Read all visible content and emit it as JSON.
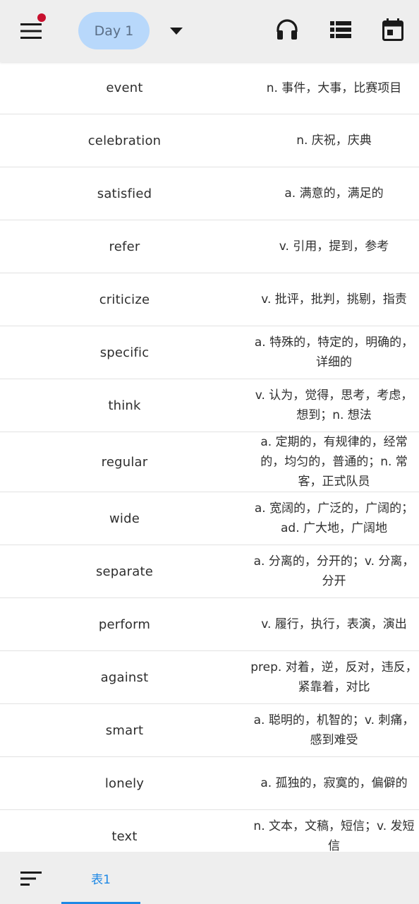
{
  "header": {
    "day_label": "Day 1"
  },
  "words": [
    {
      "word": "event",
      "meaning": "n. 事件，大事，比赛项目",
      "h": 74
    },
    {
      "word": "celebration",
      "meaning": "n. 庆祝，庆典",
      "h": 75
    },
    {
      "word": "satisfied",
      "meaning": "a. 满意的，满足的",
      "h": 75
    },
    {
      "word": "refer",
      "meaning": "v. 引用，提到，参考",
      "h": 75
    },
    {
      "word": "criticize",
      "meaning": "v. 批评，批判，挑剔，指责",
      "h": 75
    },
    {
      "word": "specific",
      "meaning": "a. 特殊的，特定的，明确的，详细的",
      "h": 75
    },
    {
      "word": "think",
      "meaning": "v. 认为，觉得，思考，考虑，想到；n. 想法",
      "h": 75
    },
    {
      "word": "regular",
      "meaning": "a. 定期的，有规律的，经常的，均匀的，普通的；n. 常客，正式队员",
      "h": 85
    },
    {
      "word": "wide",
      "meaning": "a. 宽阔的，广泛的，广阔的；ad. 广大地，广阔地",
      "h": 75
    },
    {
      "word": "separate",
      "meaning": "a. 分离的，分开的；v. 分离，分开",
      "h": 75
    },
    {
      "word": "perform",
      "meaning": "v. 履行，执行，表演，演出",
      "h": 75
    },
    {
      "word": "against",
      "meaning": "prep. 对着，逆，反对，违反，紧靠着，对比",
      "h": 75
    },
    {
      "word": "smart",
      "meaning": "a. 聪明的，机智的；v. 刺痛，感到难受",
      "h": 75
    },
    {
      "word": "lonely",
      "meaning": "a. 孤独的，寂寞的，偏僻的",
      "h": 75
    },
    {
      "word": "text",
      "meaning": "n. 文本，文稿，短信；v. 发短信",
      "h": 75
    }
  ],
  "bottom": {
    "sheet_tab_label": "表1"
  },
  "colors": {
    "accent": "#1e88e5",
    "pill": "#b8d8fb",
    "notification": "#c8102e",
    "bar": "#eeeeee"
  },
  "icons": [
    "menu-icon",
    "dropdown-arrow-icon",
    "headphones-icon",
    "list-icon",
    "calendar-icon",
    "sort-icon"
  ]
}
